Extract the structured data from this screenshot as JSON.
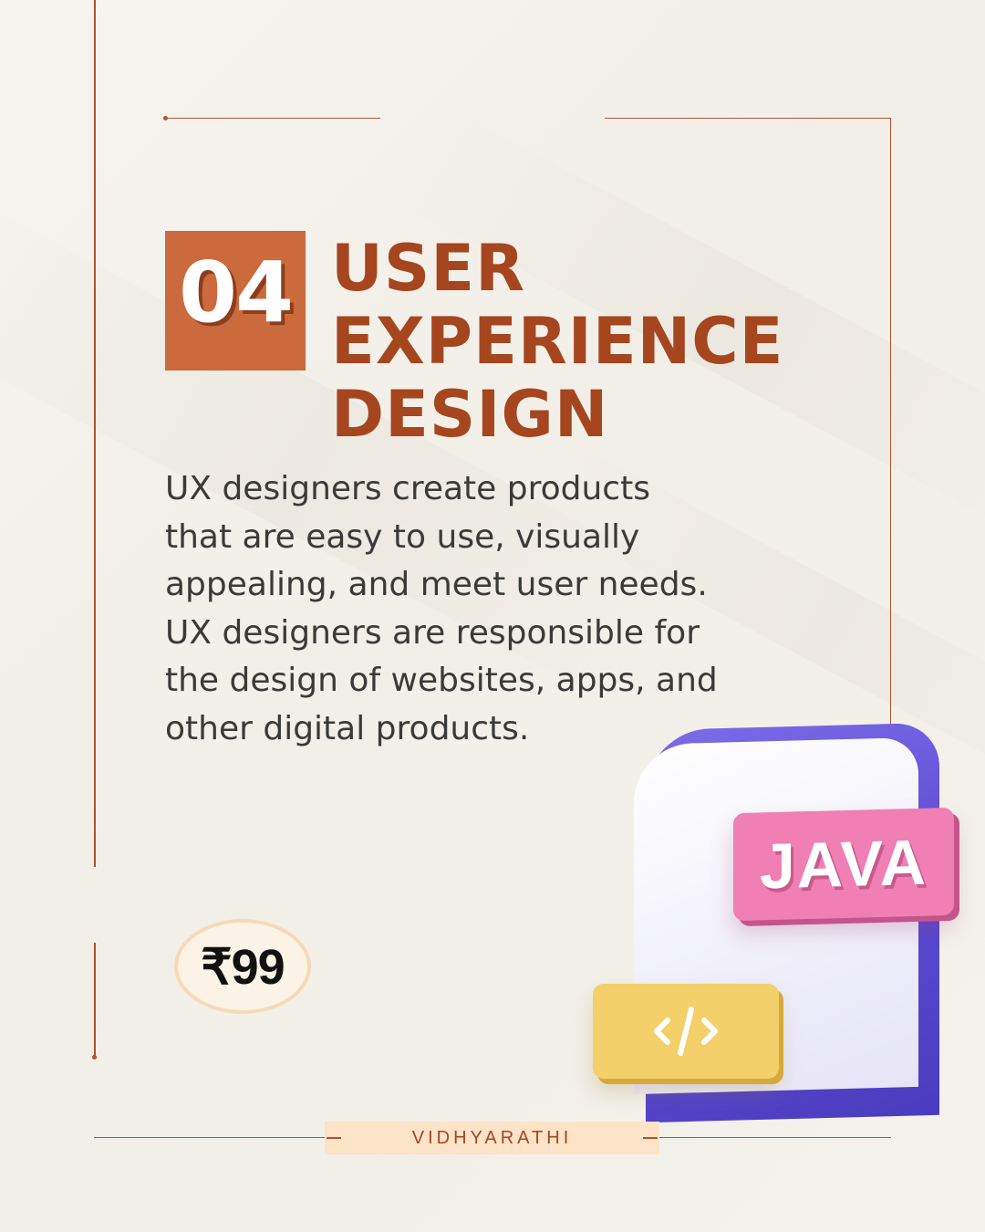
{
  "card": {
    "number": "04",
    "title_lines": [
      "USER",
      "EXPERIENCE",
      "DESIGN"
    ],
    "description_lines": [
      "UX designers create products",
      "that are easy to use, visually",
      "appealing, and meet user needs.",
      "UX designers are responsible for",
      "the design of websites, apps, and",
      "other digital products."
    ],
    "price": "₹99"
  },
  "illustration": {
    "tag_label": "JAVA",
    "code_icon": "code-brackets-icon"
  },
  "footer": {
    "brand": "VIDHYARATHI"
  },
  "colors": {
    "accent": "#cb6a3d",
    "title": "#a5461f",
    "line": "#b5532b",
    "background": "#f3f1eb",
    "java_tag": "#f07fb4",
    "code_tag": "#f3d06a",
    "phone": "#5a48d0",
    "brand_bar": "#fde3c8"
  }
}
